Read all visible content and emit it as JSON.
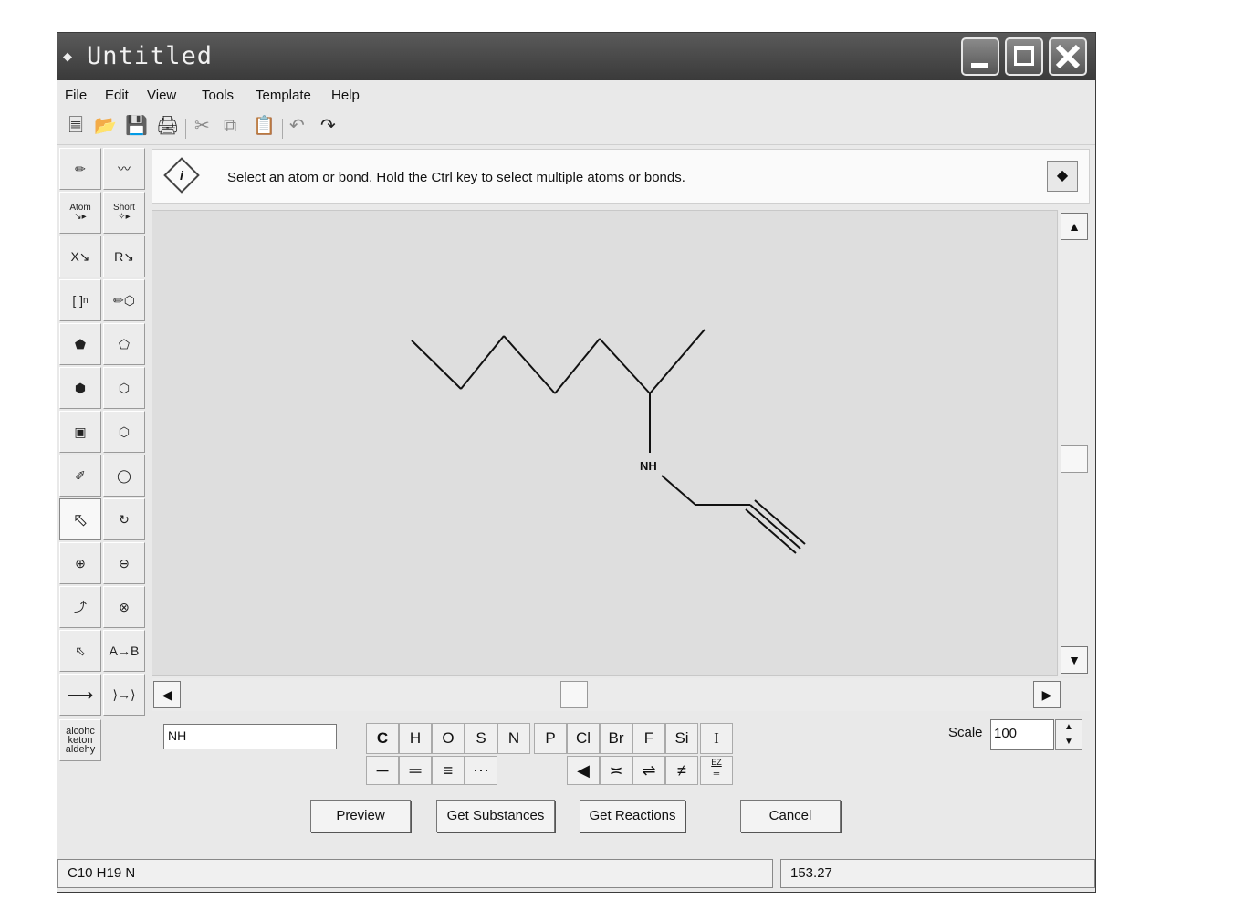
{
  "window": {
    "title": "Untitled"
  },
  "menu": [
    "File",
    "Edit",
    "View",
    "Tools",
    "Template",
    "Help"
  ],
  "toolbar_icons": [
    "new-icon",
    "open-icon",
    "save-icon",
    "print-icon",
    "cut-icon",
    "copy-icon",
    "paste-icon",
    "undo-icon",
    "redo-icon"
  ],
  "palette": {
    "atom_label": "Atom",
    "short_label": "Short",
    "x_label": "X",
    "r_label": "R",
    "bracket_label": "[ ]",
    "bracket_sub": "n",
    "ab_label": "A→B",
    "fg_label": "alcohc keton aldehy"
  },
  "info": {
    "hint": "Select an atom or bond. Hold the Ctrl key to select multiple atoms or bonds."
  },
  "molecule": {
    "atom_label": "NH"
  },
  "name_field": {
    "value": "NH"
  },
  "elements": [
    "C",
    "H",
    "O",
    "S",
    "N",
    "P",
    "Cl",
    "Br",
    "F",
    "Si",
    "I"
  ],
  "bond_tools": [
    "single-bond",
    "double-bond",
    "triple-bond",
    "any-bond",
    "up-wedge-bond",
    "down-wedge-bond",
    "up-or-down-bond",
    "hashed-bond",
    "ez-bond"
  ],
  "bond_ez_label": "EZ",
  "scale": {
    "label": "Scale",
    "value": "100"
  },
  "buttons": {
    "preview": "Preview",
    "get_substances": "Get Substances",
    "get_reactions": "Get Reactions",
    "cancel": "Cancel"
  },
  "status": {
    "formula": "C10 H19 N",
    "mass": "153.27"
  }
}
